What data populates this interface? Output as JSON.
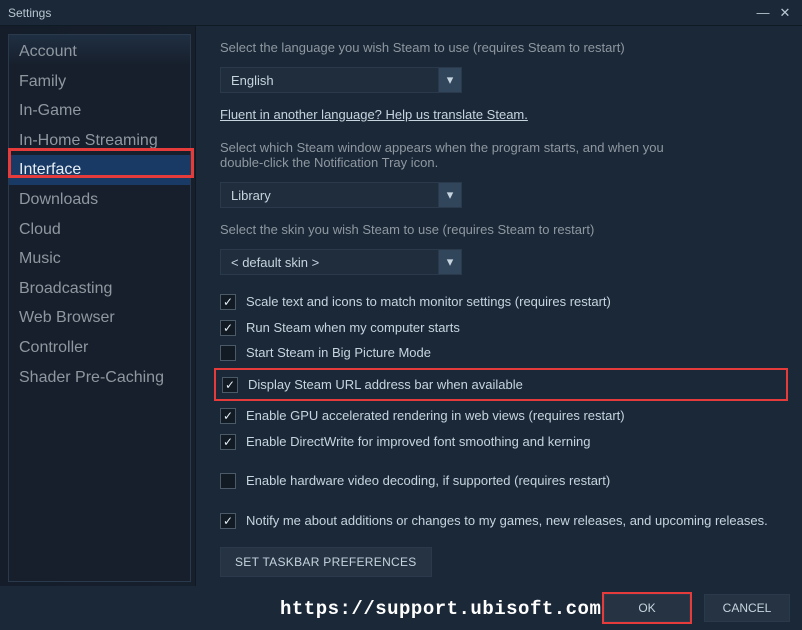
{
  "window": {
    "title": "Settings"
  },
  "sidebar": {
    "items": [
      {
        "label": "Account"
      },
      {
        "label": "Family"
      },
      {
        "label": "In-Game"
      },
      {
        "label": "In-Home Streaming"
      },
      {
        "label": "Interface"
      },
      {
        "label": "Downloads"
      },
      {
        "label": "Cloud"
      },
      {
        "label": "Music"
      },
      {
        "label": "Broadcasting"
      },
      {
        "label": "Web Browser"
      },
      {
        "label": "Controller"
      },
      {
        "label": "Shader Pre-Caching"
      }
    ],
    "selected_index": 4
  },
  "main": {
    "language_label": "Select the language you wish Steam to use (requires Steam to restart)",
    "language_value": "English",
    "fluent_link": "Fluent in another language? Help us translate Steam.",
    "startup_label": "Select which Steam window appears when the program starts, and when you double-click the Notification Tray icon.",
    "startup_value": "Library",
    "skin_label": "Select the skin you wish Steam to use (requires Steam to restart)",
    "skin_value": "< default skin >",
    "checks": [
      {
        "checked": true,
        "label": "Scale text and icons to match monitor settings (requires restart)"
      },
      {
        "checked": true,
        "label": "Run Steam when my computer starts"
      },
      {
        "checked": false,
        "label": "Start Steam in Big Picture Mode"
      },
      {
        "checked": true,
        "label": "Display Steam URL address bar when available"
      },
      {
        "checked": true,
        "label": "Enable GPU accelerated rendering in web views (requires restart)"
      },
      {
        "checked": true,
        "label": "Enable DirectWrite for improved font smoothing and kerning"
      },
      {
        "checked": false,
        "label": "Enable hardware video decoding, if supported (requires restart)"
      },
      {
        "checked": true,
        "label": "Notify me about additions or changes to my games, new releases, and upcoming releases."
      }
    ],
    "highlight_index": 3,
    "taskbar_button": "SET TASKBAR PREFERENCES"
  },
  "footer": {
    "ok": "OK",
    "cancel": "CANCEL"
  },
  "watermark": "https://support.ubisoft.com"
}
